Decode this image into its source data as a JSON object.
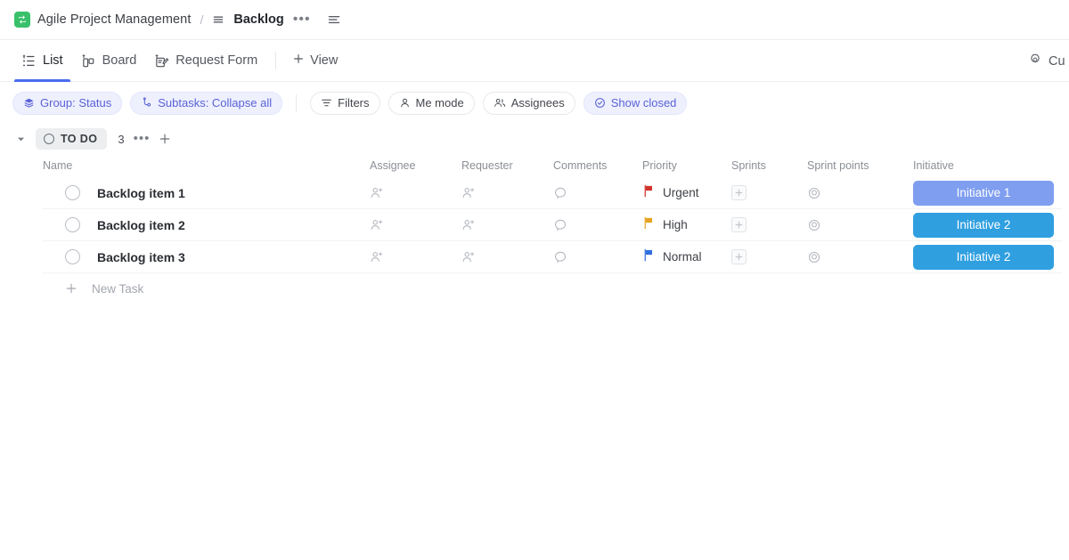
{
  "breadcrumb": {
    "space_logo_icon": "sync-arrows-icon",
    "space_logo_color": "#39c06b",
    "space_name": "Agile Project Management",
    "separator": "/",
    "list_icon": "list-lines-icon",
    "list_name": "Backlog",
    "more_label": "•••",
    "menu_icon": "hamburger-icon"
  },
  "view_tabs": [
    {
      "label": "List",
      "icon": "list-view-icon",
      "active": true
    },
    {
      "label": "Board",
      "icon": "board-view-icon",
      "active": false
    },
    {
      "label": "Request Form",
      "icon": "form-view-icon",
      "active": false
    }
  ],
  "add_view": {
    "label": "View",
    "icon": "plus-icon"
  },
  "viewbar_right": {
    "label": "Cu",
    "icon": "gear-icon"
  },
  "active_tab_underline_color": "#4a6cf0",
  "filters": [
    {
      "label": "Group: Status",
      "icon": "layers-icon",
      "style": "purple"
    },
    {
      "label": "Subtasks: Collapse all",
      "icon": "subtask-icon",
      "style": "purple"
    },
    {
      "label": "Filters",
      "icon": "filter-icon",
      "style": "plain"
    },
    {
      "label": "Me mode",
      "icon": "person-icon",
      "style": "plain"
    },
    {
      "label": "Assignees",
      "icon": "people-icon",
      "style": "plain"
    },
    {
      "label": "Show closed",
      "icon": "check-circle-icon",
      "style": "purple"
    }
  ],
  "group": {
    "caret_icon": "caret-down-icon",
    "status_icon": "status-ring-icon",
    "status_label": "TO DO",
    "count": "3",
    "more_label": "•••",
    "add_icon": "plus-icon"
  },
  "columns": [
    "Name",
    "Assignee",
    "Requester",
    "Comments",
    "Priority",
    "Sprints",
    "Sprint points",
    "Initiative"
  ],
  "rows": [
    {
      "name": "Backlog item 1",
      "status_icon": "task-status-circle-icon",
      "assignee_icon": "person-plus-icon",
      "requester_icon": "person-plus-icon",
      "comments_icon": "comment-bubble-icon",
      "priority": "Urgent",
      "priority_color": "#d0342c",
      "priority_icon": "flag-icon",
      "sprint_icon": "plus-box-icon",
      "sprint_points_icon": "pentagon-circle-icon",
      "initiative": "Initiative 1",
      "initiative_color": "#7f9ef0"
    },
    {
      "name": "Backlog item 2",
      "status_icon": "task-status-circle-icon",
      "assignee_icon": "person-plus-icon",
      "requester_icon": "person-plus-icon",
      "comments_icon": "comment-bubble-icon",
      "priority": "High",
      "priority_color": "#e5a321",
      "priority_icon": "flag-icon",
      "sprint_icon": "plus-box-icon",
      "sprint_points_icon": "pentagon-circle-icon",
      "initiative": "Initiative 2",
      "initiative_color": "#2f9fe0"
    },
    {
      "name": "Backlog item 3",
      "status_icon": "task-status-circle-icon",
      "assignee_icon": "person-plus-icon",
      "requester_icon": "person-plus-icon",
      "comments_icon": "comment-bubble-icon",
      "priority": "Normal",
      "priority_color": "#2f6fe0",
      "priority_icon": "flag-icon",
      "sprint_icon": "plus-box-icon",
      "sprint_points_icon": "pentagon-circle-icon",
      "initiative": "Initiative 2",
      "initiative_color": "#2f9fe0"
    }
  ],
  "new_task": {
    "label": "New Task",
    "icon": "plus-icon"
  }
}
